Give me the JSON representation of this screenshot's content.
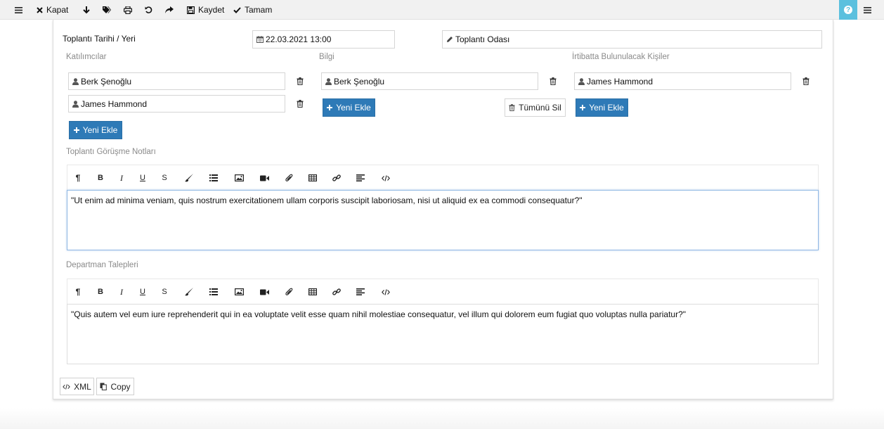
{
  "toolbar": {
    "close_label": "Kapat",
    "save_label": "Kaydet",
    "ok_label": "Tamam",
    "help_label": "?"
  },
  "meeting": {
    "date_label": "Toplantı Tarihi / Yeri",
    "date_value": "22.03.2021 13:00",
    "place_value": "Toplantı Odası"
  },
  "participants": {
    "label": "Katılımcılar",
    "items": [
      "Berk Şenoğlu",
      "James Hammond"
    ],
    "add_label": "Yeni Ekle"
  },
  "info": {
    "label": "Bilgi",
    "items": [
      "Berk Şenoğlu"
    ],
    "add_label": "Yeni Ekle",
    "delete_all_label": "Tümünü Sil"
  },
  "contacts": {
    "label": "İrtibatta Bulunulacak Kişiler",
    "items": [
      "James Hammond"
    ],
    "add_label": "Yeni Ekle"
  },
  "notes": {
    "label": "Toplantı Görüşme Notları",
    "content": "\"Ut enim ad minima veniam, quis nostrum exercitationem ullam corporis suscipit laboriosam, nisi ut aliquid ex ea commodi consequatur?\""
  },
  "requests": {
    "label": "Departman Talepleri",
    "content": "\"Quis autem vel eum iure reprehenderit qui in ea voluptate velit esse quam nihil molestiae consequatur, vel illum qui dolorem eum fugiat quo voluptas nulla pariatur?\""
  },
  "editor_icons": [
    "paragraph-icon",
    "bold-icon",
    "italic-icon",
    "underline-icon",
    "strikethrough-icon",
    "brush-icon",
    "list-icon",
    "image-icon",
    "video-icon",
    "attachment-icon",
    "table-icon",
    "link-icon",
    "align-icon",
    "code-icon"
  ],
  "editor_glyphs": {
    "bold": "B",
    "italic": "I",
    "underline": "U",
    "strike": "S",
    "paragraph": "¶"
  },
  "footer": {
    "xml_label": "XML",
    "copy_label": "Copy"
  },
  "colors": {
    "primary": "#2e7ab7",
    "help": "#5bc0de",
    "toolbar_bg": "#f1f1f1"
  }
}
